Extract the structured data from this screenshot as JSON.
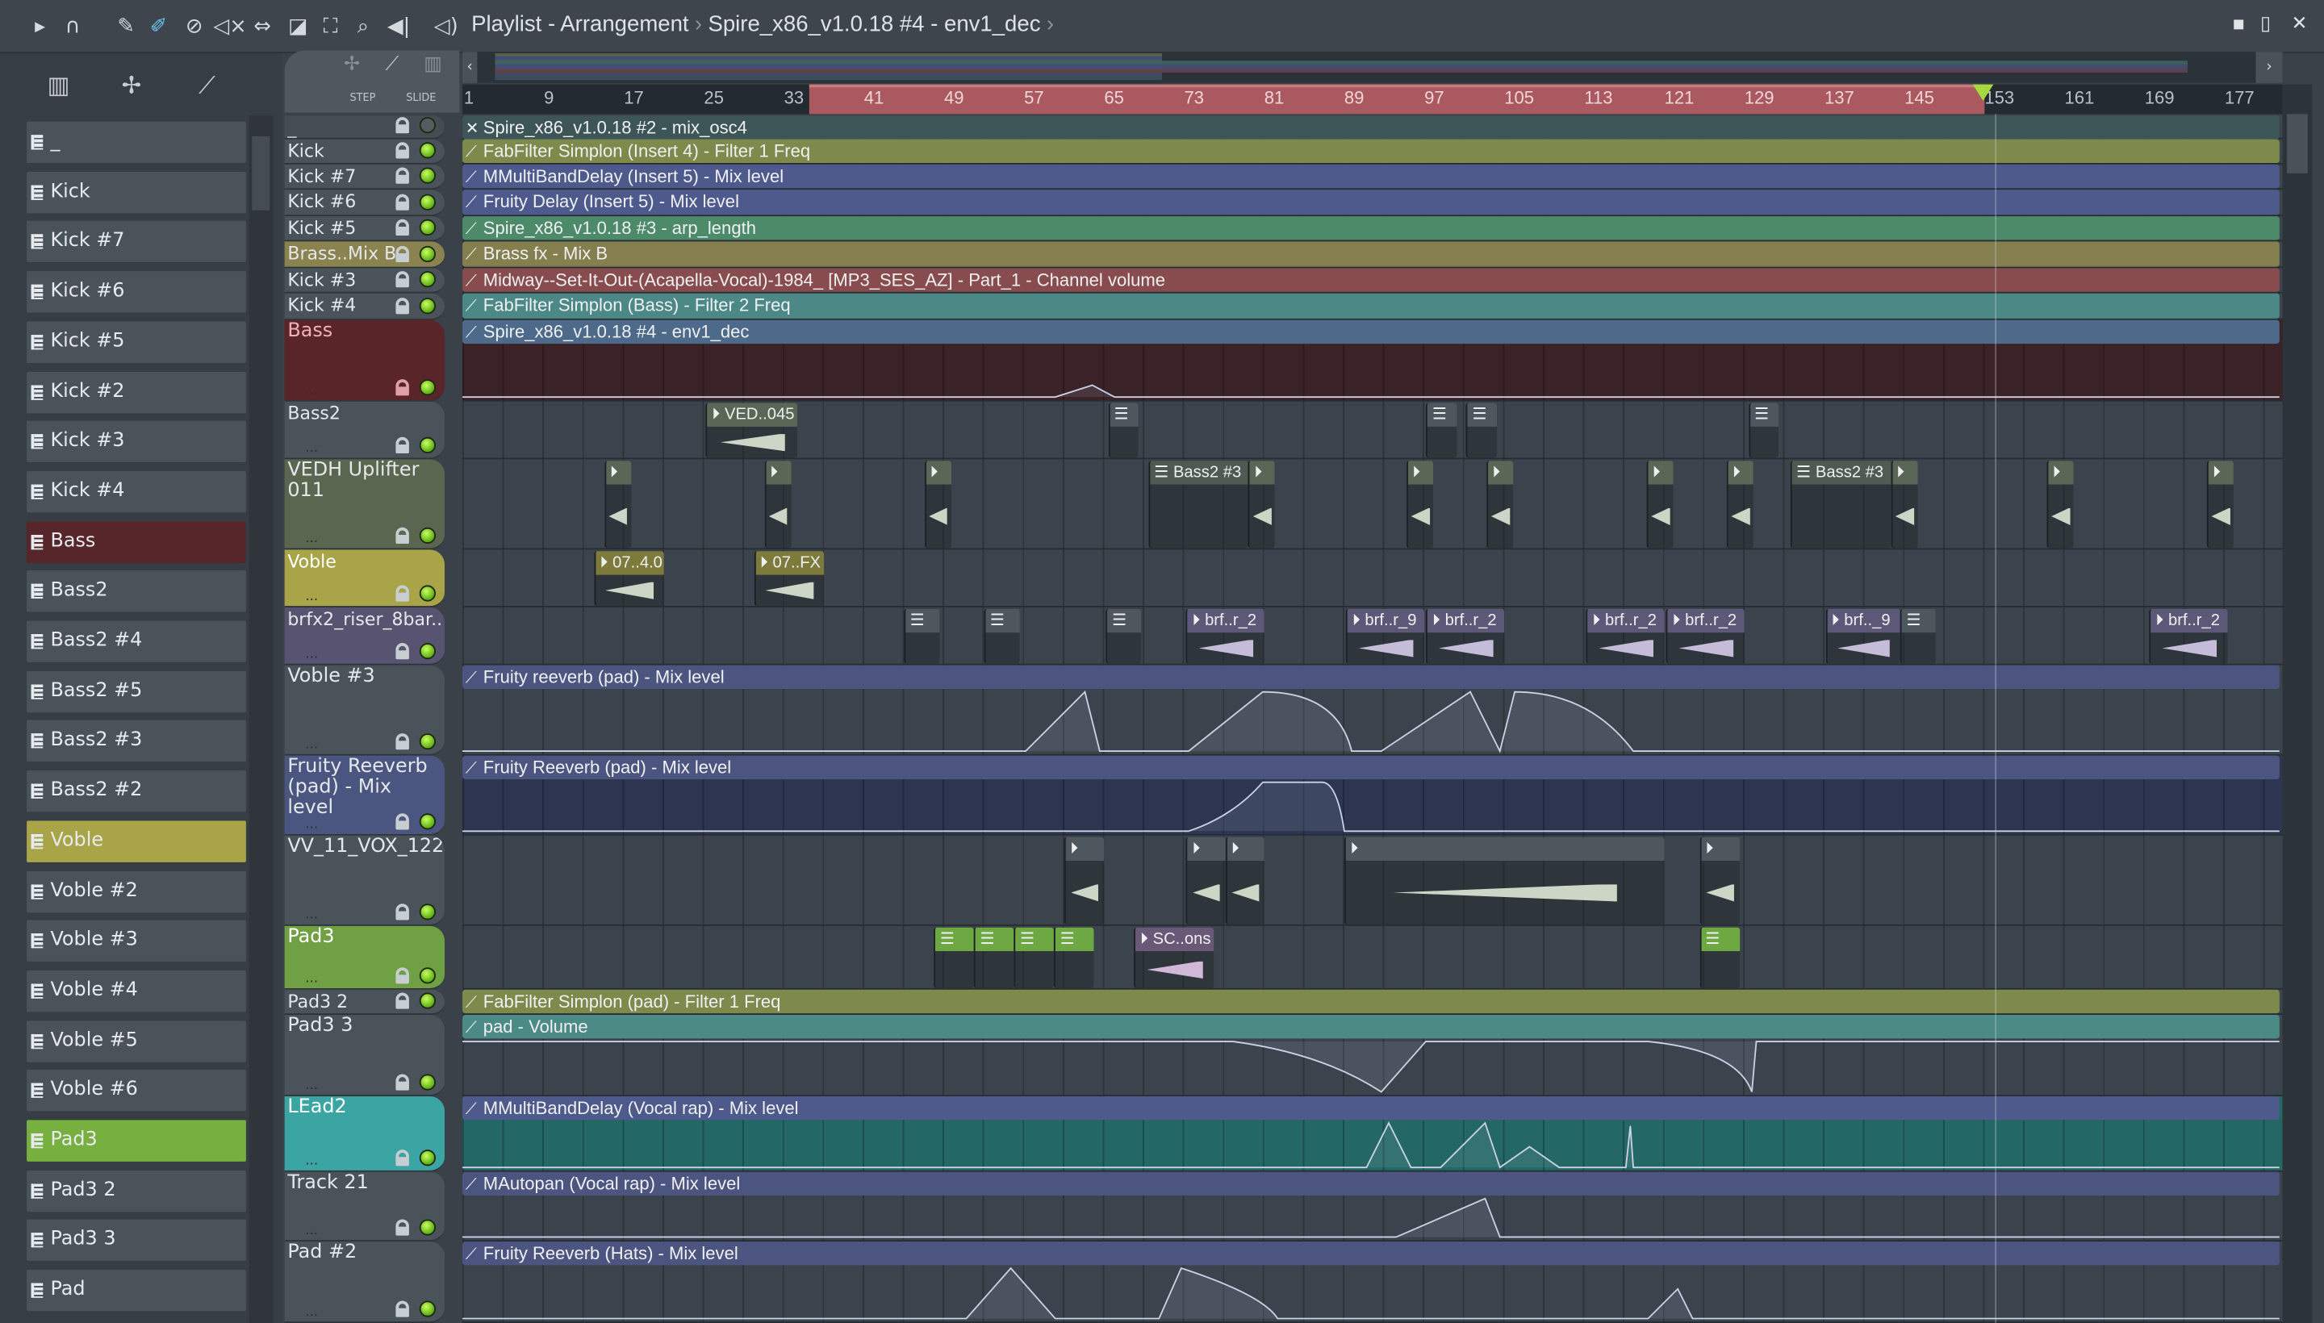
{
  "window": {
    "title": "Playlist - Arrangement",
    "breadcrumb": "Spire_x86_v1.0.18 #4 - env1_dec",
    "minimize": "▪",
    "maximize": "▯",
    "close": "✕"
  },
  "toolbar": {
    "icons": [
      "play-arrow-icon",
      "magnet-icon",
      "pencil-icon",
      "paint-icon",
      "delete-icon",
      "mute-icon",
      "slip-icon",
      "slice-icon",
      "select-icon",
      "zoom-icon",
      "playback-icon",
      "speaker-icon"
    ]
  },
  "header_tools": {
    "step": "STEP",
    "slide": "SLIDE"
  },
  "ruler": {
    "labels": [
      "1",
      "9",
      "17",
      "25",
      "33",
      "41",
      "49",
      "57",
      "65",
      "73",
      "81",
      "89",
      "97",
      "105",
      "113",
      "121",
      "129",
      "137",
      "145",
      "153",
      "161",
      "169",
      "177"
    ],
    "loop_start_bar": 37,
    "loop_end_bar": 153,
    "playhead_bar": 153
  },
  "browser": {
    "items": [
      {
        "label": "_"
      },
      {
        "label": "Kick"
      },
      {
        "label": "Kick #7"
      },
      {
        "label": "Kick #6"
      },
      {
        "label": "Kick #5"
      },
      {
        "label": "Kick #2"
      },
      {
        "label": "Kick #3"
      },
      {
        "label": "Kick #4"
      },
      {
        "label": "Bass",
        "color": "#57262a"
      },
      {
        "label": "Bass2"
      },
      {
        "label": "Bass2 #4"
      },
      {
        "label": "Bass2 #5"
      },
      {
        "label": "Bass2 #3"
      },
      {
        "label": "Bass2 #2"
      },
      {
        "label": "Voble",
        "color": "#a8a447"
      },
      {
        "label": "Voble #2"
      },
      {
        "label": "Voble #3"
      },
      {
        "label": "Voble #4"
      },
      {
        "label": "Voble #5"
      },
      {
        "label": "Voble #6"
      },
      {
        "label": "Pad3",
        "color": "#78b040"
      },
      {
        "label": "Pad3 2"
      },
      {
        "label": "Pad3 3"
      },
      {
        "label": "Pad"
      }
    ]
  },
  "tracks": [
    {
      "name": "_",
      "color": "#454c53",
      "auto": "Spire_x86_v1.0.18 #2 - mix_osc4",
      "auto_color": "#3e5558"
    },
    {
      "name": "Kick",
      "color": "#4a525a",
      "auto": "FabFilter Simplon (Insert 4) - Filter 1 Freq",
      "auto_color": "#7e894c"
    },
    {
      "name": "Kick #7",
      "color": "#4a525a",
      "auto": "MMultiBandDelay (Insert 5) - Mix level",
      "auto_color": "#4f5a8c"
    },
    {
      "name": "Kick #6",
      "color": "#4a525a",
      "auto": "Fruity Delay (Insert 5) - Mix level",
      "auto_color": "#4f5a8c"
    },
    {
      "name": "Kick #5",
      "color": "#4a525a",
      "auto": "Spire_x86_v1.0.18 #3 - arp_length",
      "auto_color": "#4c8a6a"
    },
    {
      "name": "Brass..Mix B",
      "color": "#8a8350",
      "auto": "Brass fx - Mix B",
      "auto_color": "#857e4e"
    },
    {
      "name": "Kick #3",
      "color": "#4a525a",
      "auto": "Midway--Set-It-Out-(Acapella-Vocal)-1984_ [MP3_SES_AZ] - Part_1 - Channel volume",
      "auto_color": "#884c4e"
    },
    {
      "name": "Kick #4",
      "color": "#4a525a",
      "auto": "FabFilter Simplon (Bass) - Filter 2 Freq",
      "auto_color": "#4c8885"
    },
    {
      "name": "Bass",
      "color": "#5a2528",
      "text": "#f0b0b4",
      "auto": "Spire_x86_v1.0.18 #4 - env1_dec",
      "auto_color": "#4d6a8a",
      "lane": "#3a2226"
    },
    {
      "name": "Bass2",
      "color": "#4a525a"
    },
    {
      "name": "VEDH Uplifter 011",
      "color": "#5b6650"
    },
    {
      "name": "Voble",
      "color": "#a8a447",
      "text": "#ffffff"
    },
    {
      "name": "brfx2_riser_8bar..",
      "color": "#575370"
    },
    {
      "name": "Voble #3",
      "color": "#4a525a",
      "auto": "Fruity reeverb (pad) - Mix level",
      "auto_color": "#4c5580"
    },
    {
      "name": "Fruity Reeverb (pad) - Mix level",
      "color": "#4a5680",
      "auto": "Fruity Reeverb (pad) - Mix level",
      "auto_color": "#4c5580",
      "lane": "#2d3550"
    },
    {
      "name": "VV_11_VOX_122",
      "color": "#4a525a"
    },
    {
      "name": "Pad3",
      "color": "#6fa043",
      "text": "#ffffff"
    },
    {
      "name": "Pad3 2",
      "color": "#4a525a",
      "auto": "FabFilter Simplon (pad) - Filter 1 Freq",
      "auto_color": "#7e894c"
    },
    {
      "name": "Pad3 3",
      "color": "#4a525a",
      "auto": "pad - Volume",
      "auto_color": "#4c8a85"
    },
    {
      "name": "LEad2",
      "color": "#3aa5a3",
      "text": "#ffffff",
      "auto": "MMultiBandDelay (Vocal rap) - Mix level",
      "auto_color": "#4f5a8c",
      "lane": "#236865"
    },
    {
      "name": "Track 21",
      "color": "#4a525a",
      "auto": "MAutopan (Vocal rap) - Mix level",
      "auto_color": "#4c5580"
    },
    {
      "name": "Pad #2",
      "color": "#4a525a",
      "auto": "Fruity Reeverb (Hats) - Mix level",
      "auto_color": "#4c5580"
    }
  ],
  "clips": [
    {
      "track": 9,
      "label": "VED..045",
      "start": 25.2,
      "len": 9.2,
      "kind": "audio",
      "color": "#5a6656"
    },
    {
      "track": 9,
      "label": "",
      "start": 65.4,
      "len": 3,
      "kind": "pattern",
      "color": "#4e565e"
    },
    {
      "track": 9,
      "label": "",
      "start": 97.2,
      "len": 3,
      "kind": "pattern",
      "color": "#4e565e"
    },
    {
      "track": 9,
      "label": "",
      "start": 101.2,
      "len": 3,
      "kind": "pattern",
      "color": "#4e565e"
    },
    {
      "track": 9,
      "label": "",
      "start": 129.4,
      "len": 3,
      "kind": "pattern",
      "color": "#4e565e"
    },
    {
      "track": 10,
      "label": "",
      "start": 15,
      "len": 2.7,
      "kind": "audio",
      "color": "#5a6656"
    },
    {
      "track": 10,
      "label": "",
      "start": 31,
      "len": 2.7,
      "kind": "audio",
      "color": "#5a6656"
    },
    {
      "track": 10,
      "label": "",
      "start": 47,
      "len": 2.7,
      "kind": "audio",
      "color": "#5a6656"
    },
    {
      "track": 10,
      "label": "Bass2 #3",
      "start": 69.4,
      "len": 10,
      "kind": "pattern",
      "color": "#4e5a52"
    },
    {
      "track": 10,
      "label": "",
      "start": 79.4,
      "len": 2.7,
      "kind": "audio",
      "color": "#5a6656"
    },
    {
      "track": 10,
      "label": "",
      "start": 95.2,
      "len": 2.7,
      "kind": "audio",
      "color": "#5a6656"
    },
    {
      "track": 10,
      "label": "",
      "start": 103.2,
      "len": 2.7,
      "kind": "audio",
      "color": "#5a6656"
    },
    {
      "track": 10,
      "label": "",
      "start": 119.2,
      "len": 2.7,
      "kind": "audio",
      "color": "#5a6656"
    },
    {
      "track": 10,
      "label": "",
      "start": 127.2,
      "len": 2.7,
      "kind": "audio",
      "color": "#5a6656"
    },
    {
      "track": 10,
      "label": "Bass2 #3",
      "start": 133.6,
      "len": 10,
      "kind": "pattern",
      "color": "#4e5a52"
    },
    {
      "track": 10,
      "label": "",
      "start": 143.6,
      "len": 2.7,
      "kind": "audio",
      "color": "#5a6656"
    },
    {
      "track": 10,
      "label": "",
      "start": 159.2,
      "len": 2.7,
      "kind": "audio",
      "color": "#5a6656"
    },
    {
      "track": 10,
      "label": "",
      "start": 175.2,
      "len": 2.7,
      "kind": "audio",
      "color": "#5a6656"
    },
    {
      "track": 11,
      "label": "07..4.0",
      "start": 14,
      "len": 7,
      "kind": "audio",
      "color": "#7d7a3c"
    },
    {
      "track": 11,
      "label": "07..FX",
      "start": 30,
      "len": 7,
      "kind": "audio",
      "color": "#7d7a3c"
    },
    {
      "track": 12,
      "label": "",
      "start": 45,
      "len": 3.5,
      "kind": "pattern",
      "color": "#4e565e"
    },
    {
      "track": 12,
      "label": "",
      "start": 53,
      "len": 3.5,
      "kind": "pattern",
      "color": "#4e565e"
    },
    {
      "track": 12,
      "label": "",
      "start": 65.2,
      "len": 3.5,
      "kind": "pattern",
      "color": "#4e565e"
    },
    {
      "track": 12,
      "label": "brf..r_2",
      "start": 73.2,
      "len": 7.8,
      "kind": "audio",
      "color": "#5d5878"
    },
    {
      "track": 12,
      "label": "brf..r_9",
      "start": 89.2,
      "len": 7.8,
      "kind": "audio",
      "color": "#5d5878"
    },
    {
      "track": 12,
      "label": "brf..r_2",
      "start": 97.2,
      "len": 7.8,
      "kind": "audio",
      "color": "#5d5878"
    },
    {
      "track": 12,
      "label": "brf..r_2",
      "start": 113.2,
      "len": 7.8,
      "kind": "audio",
      "color": "#5d5878"
    },
    {
      "track": 12,
      "label": "brf..r_2",
      "start": 121.2,
      "len": 7.8,
      "kind": "audio",
      "color": "#5d5878"
    },
    {
      "track": 12,
      "label": "brf.._9",
      "start": 137.1,
      "len": 7.5,
      "kind": "audio",
      "color": "#5d5878"
    },
    {
      "track": 12,
      "label": "",
      "start": 144.6,
      "len": 3.5,
      "kind": "pattern",
      "color": "#4e565e"
    },
    {
      "track": 12,
      "label": "brf..r_2",
      "start": 169.5,
      "len": 7.8,
      "kind": "audio",
      "color": "#5d5878"
    },
    {
      "track": 15,
      "label": "",
      "start": 61,
      "len": 4,
      "kind": "audio",
      "color": "#4e565e"
    },
    {
      "track": 15,
      "label": "",
      "start": 73.2,
      "len": 3.9,
      "kind": "audio",
      "color": "#4e565e"
    },
    {
      "track": 15,
      "label": "",
      "start": 77.1,
      "len": 3.9,
      "kind": "audio",
      "color": "#4e565e"
    },
    {
      "track": 15,
      "label": "",
      "start": 89,
      "len": 32,
      "kind": "audio",
      "color": "#4e565e"
    },
    {
      "track": 15,
      "label": "",
      "start": 124.5,
      "len": 4,
      "kind": "audio",
      "color": "#4e565e"
    },
    {
      "track": 16,
      "label": "",
      "start": 48,
      "len": 4,
      "kind": "pattern",
      "color": "#6ea843"
    },
    {
      "track": 16,
      "label": "",
      "start": 52,
      "len": 4,
      "kind": "pattern",
      "color": "#6ea843"
    },
    {
      "track": 16,
      "label": "",
      "start": 56,
      "len": 4,
      "kind": "pattern",
      "color": "#6ea843"
    },
    {
      "track": 16,
      "label": "",
      "start": 60,
      "len": 4,
      "kind": "pattern",
      "color": "#6ea843"
    },
    {
      "track": 16,
      "label": "SC..ons",
      "start": 68,
      "len": 8,
      "kind": "audio",
      "color": "#6a5878"
    },
    {
      "track": 16,
      "label": "",
      "start": 124.5,
      "len": 4,
      "kind": "pattern",
      "color": "#6ea843"
    }
  ]
}
